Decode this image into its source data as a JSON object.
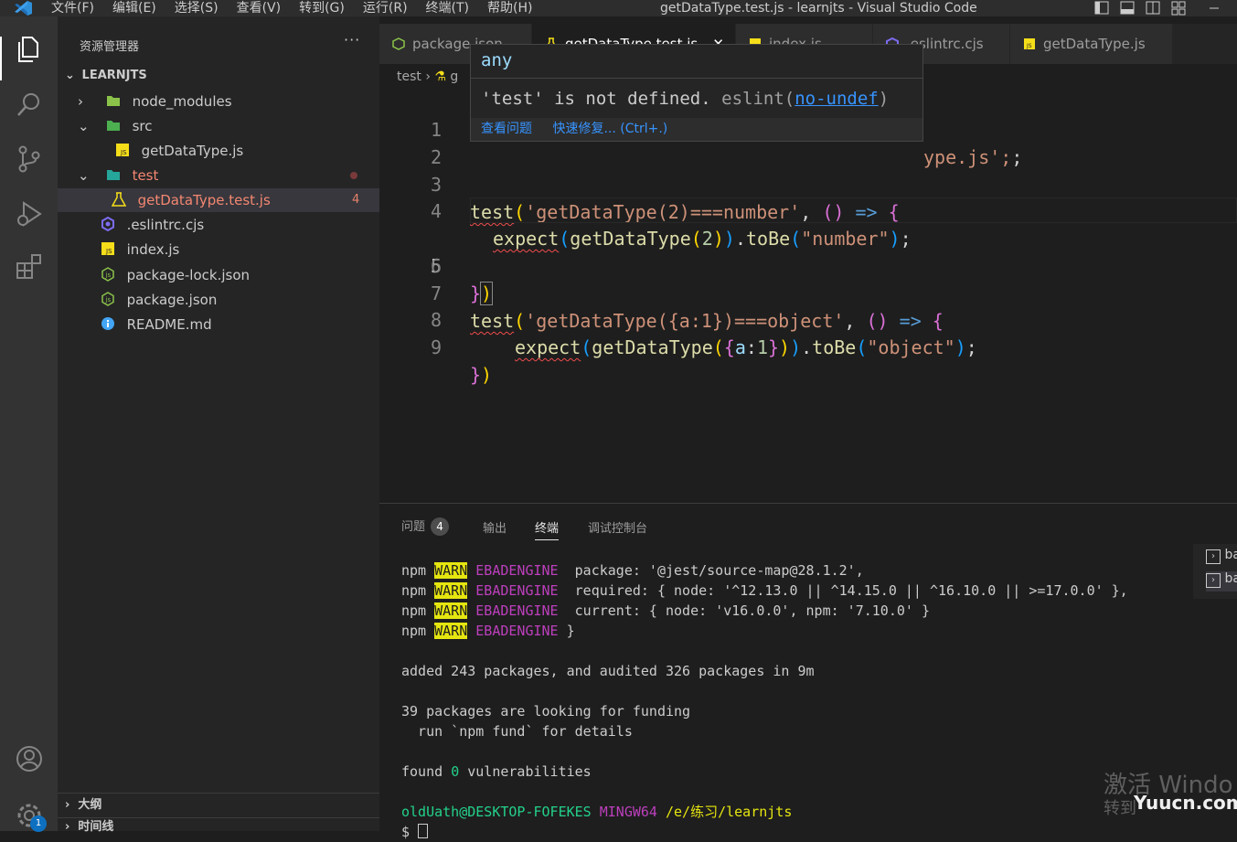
{
  "window": {
    "title": "getDataType.test.js - learnjts - Visual Studio Code",
    "menu": [
      "文件(F)",
      "编辑(E)",
      "选择(S)",
      "查看(V)",
      "转到(G)",
      "运行(R)",
      "终端(T)",
      "帮助(H)"
    ]
  },
  "activity_bar": {
    "items": [
      "explorer-icon",
      "search-icon",
      "source-control-icon",
      "run-debug-icon",
      "extensions-icon",
      "account-icon",
      "settings-icon"
    ],
    "settings_badge": "1"
  },
  "sidebar": {
    "title": "资源管理器",
    "more": "···",
    "project": "LEARNJTS",
    "tree": [
      {
        "label": "node_modules",
        "icon": "folder-node-icon"
      },
      {
        "label": "src",
        "icon": "folder-src-icon"
      },
      {
        "label": "getDataType.js",
        "icon": "js-file-icon"
      },
      {
        "label": "test",
        "icon": "folder-test-icon"
      },
      {
        "label": "getDataType.test.js",
        "icon": "test-file-icon",
        "problems": "4"
      },
      {
        "label": ".eslintrc.cjs",
        "icon": "eslint-icon"
      },
      {
        "label": "index.js",
        "icon": "js-file-icon"
      },
      {
        "label": "package-lock.json",
        "icon": "node-json-icon"
      },
      {
        "label": "package.json",
        "icon": "node-json-icon"
      },
      {
        "label": "README.md",
        "icon": "info-icon"
      }
    ],
    "outline": "大纲",
    "timeline": "时间线"
  },
  "tabs": [
    {
      "label": "package.json"
    },
    {
      "label": "getDataType.test.js"
    },
    {
      "label": "index.js"
    },
    {
      "label": ".eslintrc.cjs"
    },
    {
      "label": "getDataType.js"
    }
  ],
  "breadcrumb": {
    "folder": "test",
    "file": "g"
  },
  "editor": {
    "line_numbers": [
      "1",
      "2",
      "3",
      "4",
      "5",
      "6",
      "7",
      "8",
      "9"
    ],
    "line1_tail": "ype.js';",
    "line3": {
      "fn": "test",
      "str": "'getDataType(2)===number'",
      "arrow": "=>"
    },
    "line4": {
      "fn": "expect",
      "call": "getDataType",
      "num": "2",
      "method": "toBe",
      "str": "\"number\""
    },
    "line7": {
      "fn": "test",
      "str": "'getDataType({a:1})===object'",
      "arrow": "=>"
    },
    "line8": {
      "fn": "expect",
      "call": "getDataType",
      "obj_key": "a",
      "num": "1",
      "method": "toBe",
      "str": "\"object\""
    }
  },
  "hover": {
    "type": "any",
    "message": "'test' is not defined.",
    "source": "eslint(",
    "rule": "no-undef",
    "source_end": ")",
    "actions": [
      "查看问题",
      "快速修复... (Ctrl+.)"
    ]
  },
  "panel": {
    "tabs": [
      "问题",
      "输出",
      "终端",
      "调试控制台"
    ],
    "problems_count": "4",
    "terminal": {
      "npm": "npm",
      "warn": "WARN",
      "engine": "EBADENGINE",
      "warn_lines": [
        "  package: '@jest/source-map@28.1.2',",
        "  required: { node: '^12.13.0 || ^14.15.0 || ^16.10.0 || >=17.0.0' },",
        "  current: { node: 'v16.0.0', npm: '7.10.0' }",
        " }"
      ],
      "added": "added 243 packages, and audited 326 packages in 9m",
      "funding1": "39 packages are looking for funding",
      "funding2": "  run `npm fund` for details",
      "found_pre": "found ",
      "found_num": "0",
      "found_post": " vulnerabilities",
      "prompt_user": "oldUath@DESKTOP-FOFEKES",
      "prompt_env": "MINGW64",
      "prompt_path": "/e/练习/learnjts",
      "prompt_symbol": "$"
    },
    "terminal_list": [
      "ba",
      "ba"
    ]
  },
  "watermark": {
    "line1": "激活 Windo",
    "line2": "转到",
    "site": "Yuucn.com"
  }
}
